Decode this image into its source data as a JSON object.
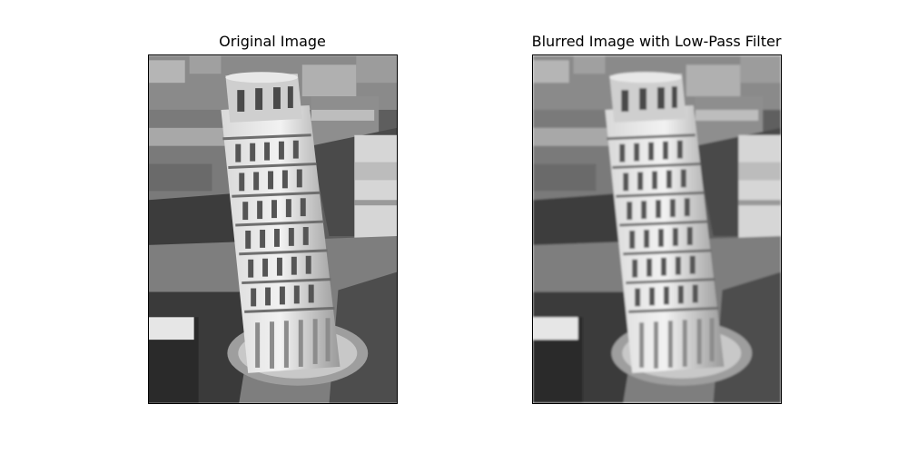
{
  "figure": {
    "panels": [
      {
        "title": "Original Image",
        "blurred": false
      },
      {
        "title": "Blurred Image with Low-Pass Filter",
        "blurred": true
      }
    ]
  }
}
